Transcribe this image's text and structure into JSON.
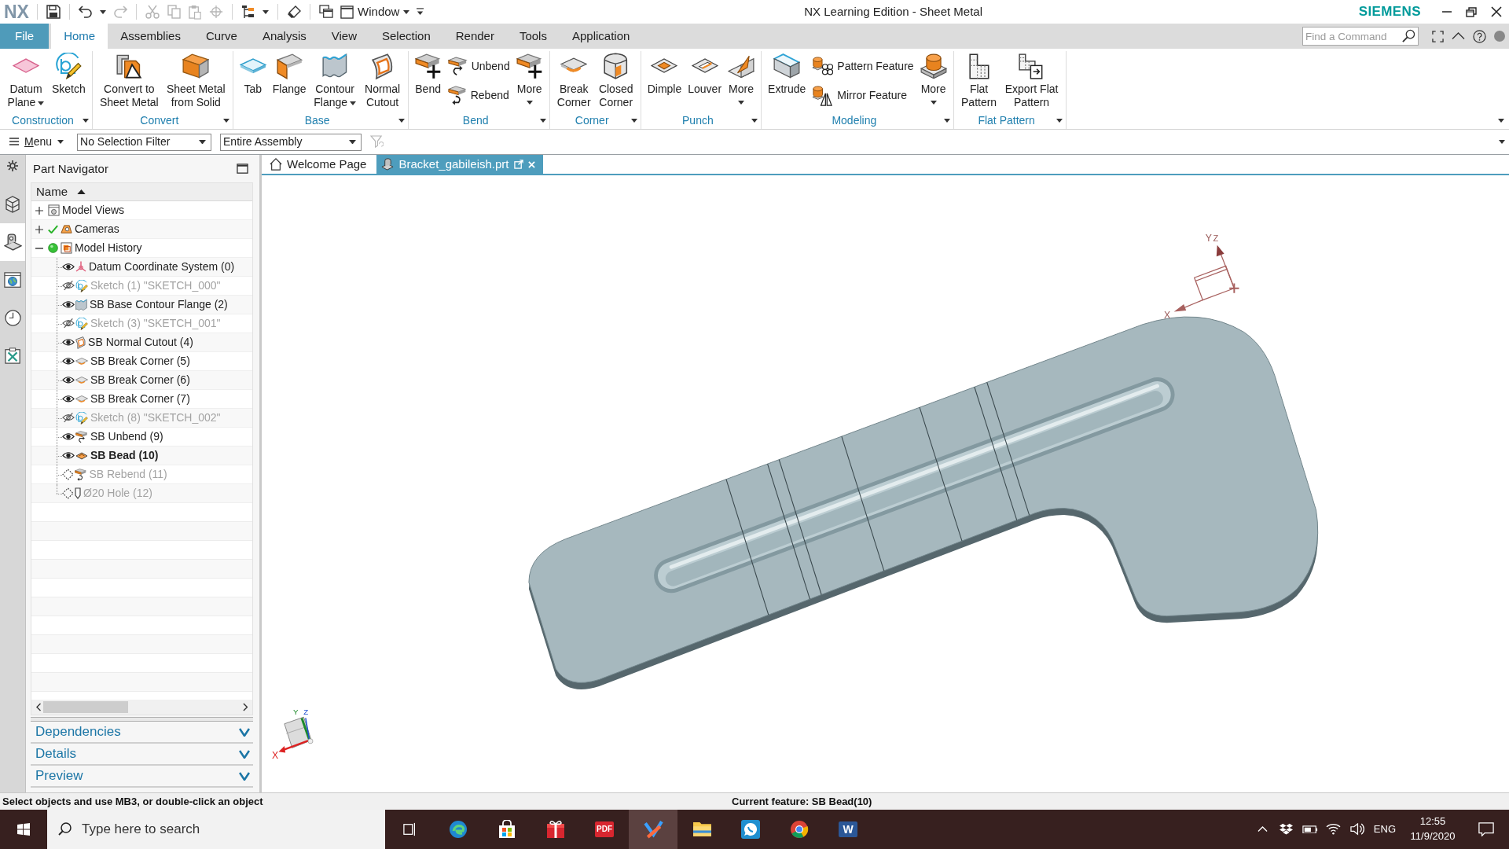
{
  "title_bar": {
    "logo": "NX",
    "window_menu": "Window",
    "title": "NX Learning Edition - Sheet Metal",
    "brand": "SIEMENS"
  },
  "ribbon_tabs": [
    {
      "label": "File",
      "kind": "file",
      "selected": false
    },
    {
      "label": "Home",
      "kind": "tab",
      "selected": true
    },
    {
      "label": "Assemblies",
      "kind": "tab",
      "selected": false
    },
    {
      "label": "Curve",
      "kind": "tab",
      "selected": false
    },
    {
      "label": "Analysis",
      "kind": "tab",
      "selected": false
    },
    {
      "label": "View",
      "kind": "tab",
      "selected": false
    },
    {
      "label": "Selection",
      "kind": "tab",
      "selected": false
    },
    {
      "label": "Render",
      "kind": "tab",
      "selected": false
    },
    {
      "label": "Tools",
      "kind": "tab",
      "selected": false
    },
    {
      "label": "Application",
      "kind": "tab",
      "selected": false
    }
  ],
  "command_search": {
    "placeholder": "Find a Command"
  },
  "ribbon_groups": [
    {
      "label": "Construction",
      "items": [
        {
          "label": "Datum Plane",
          "kind": "datum-plane",
          "dropdown": true
        },
        {
          "label": "Sketch",
          "kind": "sketch",
          "dropdown": false
        }
      ]
    },
    {
      "label": "Convert",
      "items": [
        {
          "label": "Convert to Sheet Metal",
          "kind": "convert",
          "dropdown": false
        },
        {
          "label": "Sheet Metal from Solid",
          "kind": "solid-block",
          "dropdown": false
        }
      ]
    },
    {
      "label": "Base",
      "items": [
        {
          "label": "Tab",
          "kind": "tab",
          "dropdown": false
        },
        {
          "label": "Flange",
          "kind": "flange",
          "dropdown": false
        },
        {
          "label": "Contour Flange",
          "kind": "contour-flange",
          "dropdown": true
        },
        {
          "label": "Normal Cutout",
          "kind": "cutout",
          "dropdown": false
        }
      ]
    },
    {
      "label": "Bend",
      "items": [
        {
          "label": "Bend",
          "kind": "bend",
          "dropdown": false
        },
        {
          "stack": [
            {
              "label": "Unbend",
              "kind": "unbend",
              "dropdown": false
            },
            {
              "label": "Rebend",
              "kind": "rebend",
              "dropdown": false
            }
          ]
        },
        {
          "label": "More",
          "kind": "bend-more",
          "dropdown": true
        }
      ]
    },
    {
      "label": "Corner",
      "items": [
        {
          "label": "Break Corner",
          "kind": "break-corner",
          "dropdown": false
        },
        {
          "label": "Closed Corner",
          "kind": "closed-corner",
          "dropdown": false
        }
      ]
    },
    {
      "label": "Punch",
      "items": [
        {
          "label": "Dimple",
          "kind": "dimple",
          "dropdown": false
        },
        {
          "label": "Louver",
          "kind": "louver",
          "dropdown": false
        },
        {
          "label": "More",
          "kind": "punch-more",
          "dropdown": true
        }
      ]
    },
    {
      "label": "Modeling",
      "items": [
        {
          "label": "Extrude",
          "kind": "extrude",
          "dropdown": false
        },
        {
          "stack": [
            {
              "label": "Pattern Feature",
              "kind": "pattern",
              "dropdown": false
            },
            {
              "label": "Mirror Feature",
              "kind": "mirror",
              "dropdown": false
            }
          ]
        },
        {
          "label": "More",
          "kind": "modeling-more",
          "dropdown": true
        }
      ]
    },
    {
      "label": "Flat Pattern",
      "items": [
        {
          "label": "Flat Pattern",
          "kind": "flat-pattern",
          "dropdown": false
        },
        {
          "label": "Export Flat Pattern",
          "kind": "export-flat-pattern",
          "dropdown": false
        }
      ]
    }
  ],
  "selection_bar": {
    "menu": "Menu",
    "filter": "No Selection Filter",
    "scope": "Entire Assembly"
  },
  "resource_bar": [
    {
      "kind": "settings",
      "selected": false
    },
    {
      "kind": "assembly",
      "selected": false
    },
    {
      "kind": "part",
      "selected": true
    },
    {
      "kind": "web",
      "selected": false
    },
    {
      "kind": "history",
      "selected": false
    },
    {
      "kind": "tools",
      "selected": false
    }
  ],
  "part_navigator": {
    "title": "Part Navigator",
    "column": "Name",
    "tree": [
      {
        "label": "Model Views",
        "kind": "views",
        "expanded": false
      },
      {
        "label": "Cameras",
        "kind": "cameras",
        "expanded": false
      },
      {
        "label": "Model History",
        "kind": "history",
        "expanded": true,
        "children": [
          {
            "label": "Datum Coordinate System (0)",
            "kind": "datum-csys",
            "visible": true,
            "active": true,
            "current": false
          },
          {
            "label": "Sketch (1) \"SKETCH_000\"",
            "kind": "sketch",
            "visible": false,
            "active": true,
            "current": false
          },
          {
            "label": "SB Base Contour Flange (2)",
            "kind": "contour-flange",
            "visible": true,
            "active": true,
            "current": false
          },
          {
            "label": "Sketch (3) \"SKETCH_001\"",
            "kind": "sketch",
            "visible": false,
            "active": true,
            "current": false
          },
          {
            "label": "SB Normal Cutout (4)",
            "kind": "cutout",
            "visible": true,
            "active": true,
            "current": false
          },
          {
            "label": "SB Break Corner (5)",
            "kind": "break-corner",
            "visible": true,
            "active": true,
            "current": false
          },
          {
            "label": "SB Break Corner (6)",
            "kind": "break-corner",
            "visible": true,
            "active": true,
            "current": false
          },
          {
            "label": "SB Break Corner (7)",
            "kind": "break-corner",
            "visible": true,
            "active": true,
            "current": false
          },
          {
            "label": "Sketch (8) \"SKETCH_002\"",
            "kind": "sketch",
            "visible": false,
            "active": true,
            "current": false
          },
          {
            "label": "SB Unbend (9)",
            "kind": "unbend",
            "visible": true,
            "active": true,
            "current": false
          },
          {
            "label": "SB Bead (10)",
            "kind": "bead",
            "visible": true,
            "active": true,
            "current": true
          },
          {
            "label": "SB Rebend (11)",
            "kind": "rebend",
            "visible": true,
            "active": false,
            "current": false
          },
          {
            "label": "Ø20 Hole (12)",
            "kind": "hole",
            "visible": true,
            "active": false,
            "current": false
          }
        ]
      }
    ],
    "sections": [
      {
        "label": "Dependencies",
        "expanded": false
      },
      {
        "label": "Details",
        "expanded": false
      },
      {
        "label": "Preview",
        "expanded": false
      }
    ]
  },
  "graphics": {
    "document_tabs": [
      {
        "label": "Welcome Page",
        "kind": "home",
        "selected": false
      },
      {
        "label": "Bracket_gabileish.prt",
        "kind": "part",
        "selected": true
      }
    ],
    "datum_csys": {
      "x_label": "X",
      "y_label": "Y",
      "z_label": "Z"
    },
    "view_triad": {
      "x_label": "X",
      "y_label": "Y",
      "z_label": "Z"
    }
  },
  "status_bar": {
    "prompt": "Select objects and use MB3, or double-click an object",
    "current_feature": "Current feature: SB Bead(10)"
  },
  "taskbar": {
    "search": {
      "placeholder": "Type here to search"
    },
    "apps": [
      {
        "kind": "task-view",
        "selected": false
      },
      {
        "kind": "swirl",
        "selected": false
      },
      {
        "kind": "bag",
        "selected": false
      },
      {
        "kind": "gift",
        "selected": false
      },
      {
        "kind": "pdf",
        "text": "PDF",
        "selected": false
      },
      {
        "kind": "paint",
        "selected": true
      },
      {
        "kind": "folder",
        "selected": false
      },
      {
        "kind": "chat",
        "selected": false
      },
      {
        "kind": "round",
        "selected": false
      },
      {
        "kind": "word",
        "text": "W",
        "selected": false
      }
    ],
    "language": "ENG",
    "time": "12:55",
    "date": "11/9/2020"
  }
}
